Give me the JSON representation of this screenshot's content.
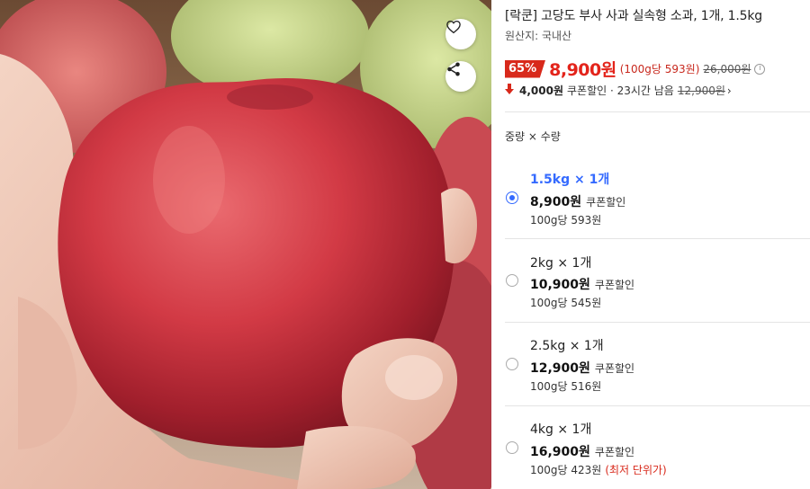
{
  "product": {
    "title": "[락쿤] 고당도 부사 사과 실속형 소과, 1개, 1.5kg",
    "origin": "원산지: 국내산"
  },
  "price": {
    "discount": "65%",
    "sale": "8,900원",
    "unit": "(100g당 593원)",
    "original": "26,000원",
    "info_icon": "i"
  },
  "coupon": {
    "amount": "4,000원",
    "desc": "쿠폰할인 · 23시간 남음",
    "prev_price": "12,900원",
    "chevron": "›"
  },
  "options": {
    "header": "중량 × 수량",
    "items": [
      {
        "name": "1.5kg × 1개",
        "price": "8,900원",
        "coupon": "쿠폰할인",
        "unit": "100g당 593원",
        "best": "",
        "selected": true
      },
      {
        "name": "2kg × 1개",
        "price": "10,900원",
        "coupon": "쿠폰할인",
        "unit": "100g당 545원",
        "best": "",
        "selected": false
      },
      {
        "name": "2.5kg × 1개",
        "price": "12,900원",
        "coupon": "쿠폰할인",
        "unit": "100g당 516원",
        "best": "",
        "selected": false
      },
      {
        "name": "4kg × 1개",
        "price": "16,900원",
        "coupon": "쿠폰할인",
        "unit": "100g당 423원",
        "best": "(최저 단위가)",
        "selected": false
      }
    ]
  },
  "icons": {
    "wish": "heart-icon",
    "share": "share-icon",
    "coupon_arrow": "down-arrow-icon"
  },
  "colors": {
    "accent_red": "#d8291b",
    "price_red": "#e3241b",
    "selected_blue": "#346aff"
  }
}
